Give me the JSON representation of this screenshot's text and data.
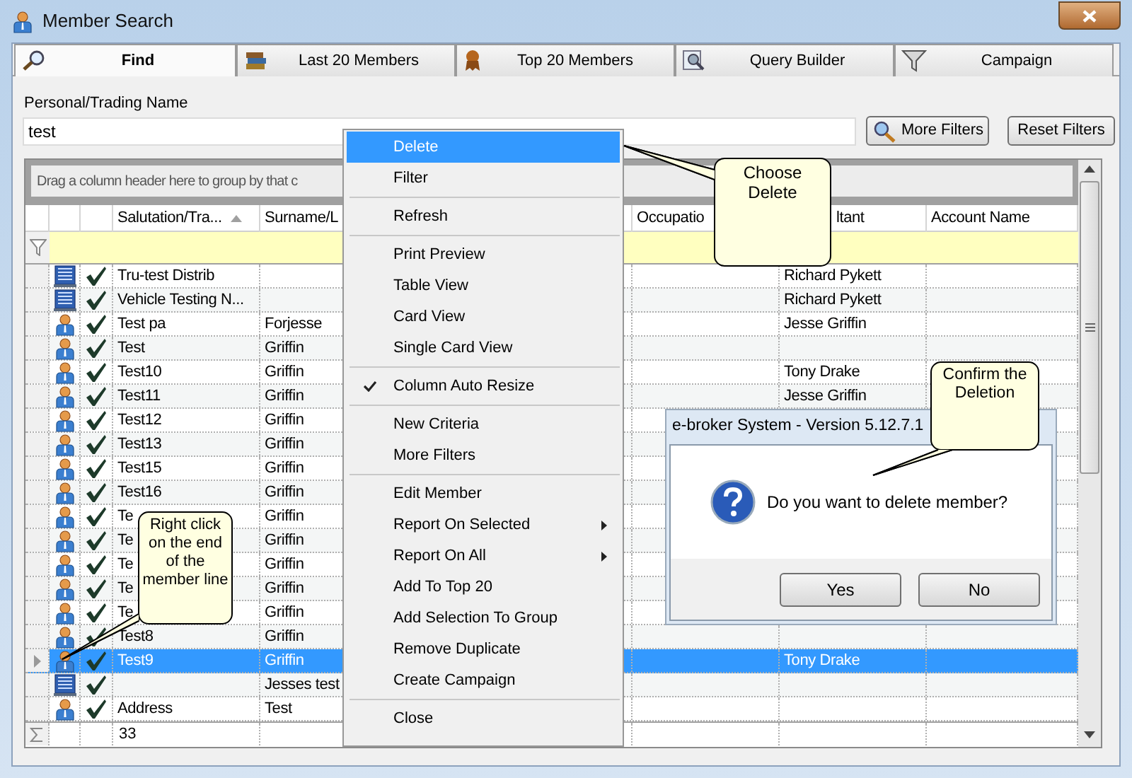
{
  "window": {
    "title": "Member Search"
  },
  "tabs": [
    {
      "label": "Find",
      "selected": true
    },
    {
      "label": "Last 20 Members",
      "selected": false
    },
    {
      "label": "Top 20 Members",
      "selected": false
    },
    {
      "label": "Query Builder",
      "selected": false
    },
    {
      "label": "Campaign",
      "selected": false
    }
  ],
  "search": {
    "label": "Personal/Trading Name",
    "value": "test"
  },
  "buttons": [
    "More Filters",
    "Reset Filters"
  ],
  "grid": {
    "group_hint": "Drag a column header here to group by that c",
    "columns": [
      {
        "label": "Salutation/Tra...",
        "sorted": true
      },
      {
        "label": "Surname/L",
        "sorted": false
      },
      {
        "label": "Occupatio",
        "sorted": false
      },
      {
        "label": "ltant",
        "sorted": false
      },
      {
        "label": "Account Name",
        "sorted": false
      }
    ],
    "rows": [
      {
        "kind": "company",
        "checked": true,
        "selected": false,
        "salutation": "Tru-test Distrib",
        "consultant": "Richard Pykett"
      },
      {
        "kind": "company",
        "checked": true,
        "selected": false,
        "salutation": "Vehicle Testing N...",
        "consultant": "Richard Pykett"
      },
      {
        "kind": "person",
        "checked": true,
        "selected": false,
        "salutation": "Test pa",
        "surname": "Forjesse",
        "consultant": "Jesse Griffin"
      },
      {
        "kind": "person",
        "checked": true,
        "selected": false,
        "salutation": "Test",
        "surname": "Griffin"
      },
      {
        "kind": "person",
        "checked": true,
        "selected": false,
        "salutation": "Test10",
        "surname": "Griffin",
        "consultant": "Tony Drake"
      },
      {
        "kind": "person",
        "checked": true,
        "selected": false,
        "salutation": "Test11",
        "surname": "Griffin",
        "consultant": "Jesse Griffin"
      },
      {
        "kind": "person",
        "checked": true,
        "selected": false,
        "salutation": "Test12",
        "surname": "Griffin"
      },
      {
        "kind": "person",
        "checked": true,
        "selected": false,
        "salutation": "Test13",
        "surname": "Griffin"
      },
      {
        "kind": "person",
        "checked": true,
        "selected": false,
        "salutation": "Test15",
        "surname": "Griffin"
      },
      {
        "kind": "person",
        "checked": true,
        "selected": false,
        "salutation": "Test16",
        "surname": "Griffin"
      },
      {
        "kind": "person",
        "checked": true,
        "selected": false,
        "salutation": "Te",
        "surname": "Griffin"
      },
      {
        "kind": "person",
        "checked": true,
        "selected": false,
        "salutation": "Te",
        "surname": "Griffin"
      },
      {
        "kind": "person",
        "checked": true,
        "selected": false,
        "salutation": "Te",
        "surname": "Griffin"
      },
      {
        "kind": "person",
        "checked": true,
        "selected": false,
        "salutation": "Te",
        "surname": "Griffin"
      },
      {
        "kind": "person",
        "checked": true,
        "selected": false,
        "salutation": "Te",
        "surname": "Griffin"
      },
      {
        "kind": "person",
        "checked": true,
        "selected": false,
        "salutation": "Test8",
        "surname": "Griffin"
      },
      {
        "kind": "person",
        "checked": true,
        "selected": true,
        "salutation": "Test9",
        "surname": "Griffin",
        "consultant": "Tony Drake"
      },
      {
        "kind": "company",
        "checked": true,
        "selected": false,
        "surname": "Jesses test"
      },
      {
        "kind": "person",
        "checked": true,
        "selected": false,
        "salutation": "Address",
        "surname": "Test"
      }
    ],
    "footer": {
      "count": "33"
    }
  },
  "context_menu": {
    "groups": [
      [
        {
          "label": "Delete",
          "highlighted": true,
          "checked": false,
          "submenu": false
        },
        {
          "label": "Filter",
          "highlighted": false,
          "checked": false,
          "submenu": false
        }
      ],
      [
        {
          "label": "Refresh",
          "highlighted": false,
          "checked": false,
          "submenu": false
        }
      ],
      [
        {
          "label": "Print Preview",
          "highlighted": false,
          "checked": false,
          "submenu": false
        },
        {
          "label": "Table View",
          "highlighted": false,
          "checked": false,
          "submenu": false
        },
        {
          "label": "Card View",
          "highlighted": false,
          "checked": false,
          "submenu": false
        },
        {
          "label": "Single Card View",
          "highlighted": false,
          "checked": false,
          "submenu": false
        }
      ],
      [
        {
          "label": "Column Auto Resize",
          "highlighted": false,
          "checked": true,
          "submenu": false
        }
      ],
      [
        {
          "label": "New Criteria",
          "highlighted": false,
          "checked": false,
          "submenu": false
        },
        {
          "label": "More Filters",
          "highlighted": false,
          "checked": false,
          "submenu": false
        }
      ],
      [
        {
          "label": "Edit Member",
          "highlighted": false,
          "checked": false,
          "submenu": false
        },
        {
          "label": "Report On Selected",
          "highlighted": false,
          "checked": false,
          "submenu": true
        },
        {
          "label": "Report On All",
          "highlighted": false,
          "checked": false,
          "submenu": true
        },
        {
          "label": "Add To Top 20",
          "highlighted": false,
          "checked": false,
          "submenu": false
        },
        {
          "label": "Add Selection To Group",
          "highlighted": false,
          "checked": false,
          "submenu": false
        },
        {
          "label": "Remove Duplicate",
          "highlighted": false,
          "checked": false,
          "submenu": false
        },
        {
          "label": "Create Campaign",
          "highlighted": false,
          "checked": false,
          "submenu": false
        }
      ],
      [
        {
          "label": "Close",
          "highlighted": false,
          "checked": false,
          "submenu": false
        }
      ]
    ]
  },
  "dialog": {
    "title": "e-broker System - Version 5.12.7.1",
    "message": "Do you want to delete member?",
    "buttons": [
      "Yes",
      "No"
    ]
  },
  "callouts": [
    {
      "text": "Choose Delete"
    },
    {
      "text": "Confirm the Deletion"
    },
    {
      "text": "Right click on the end of the member line"
    }
  ]
}
